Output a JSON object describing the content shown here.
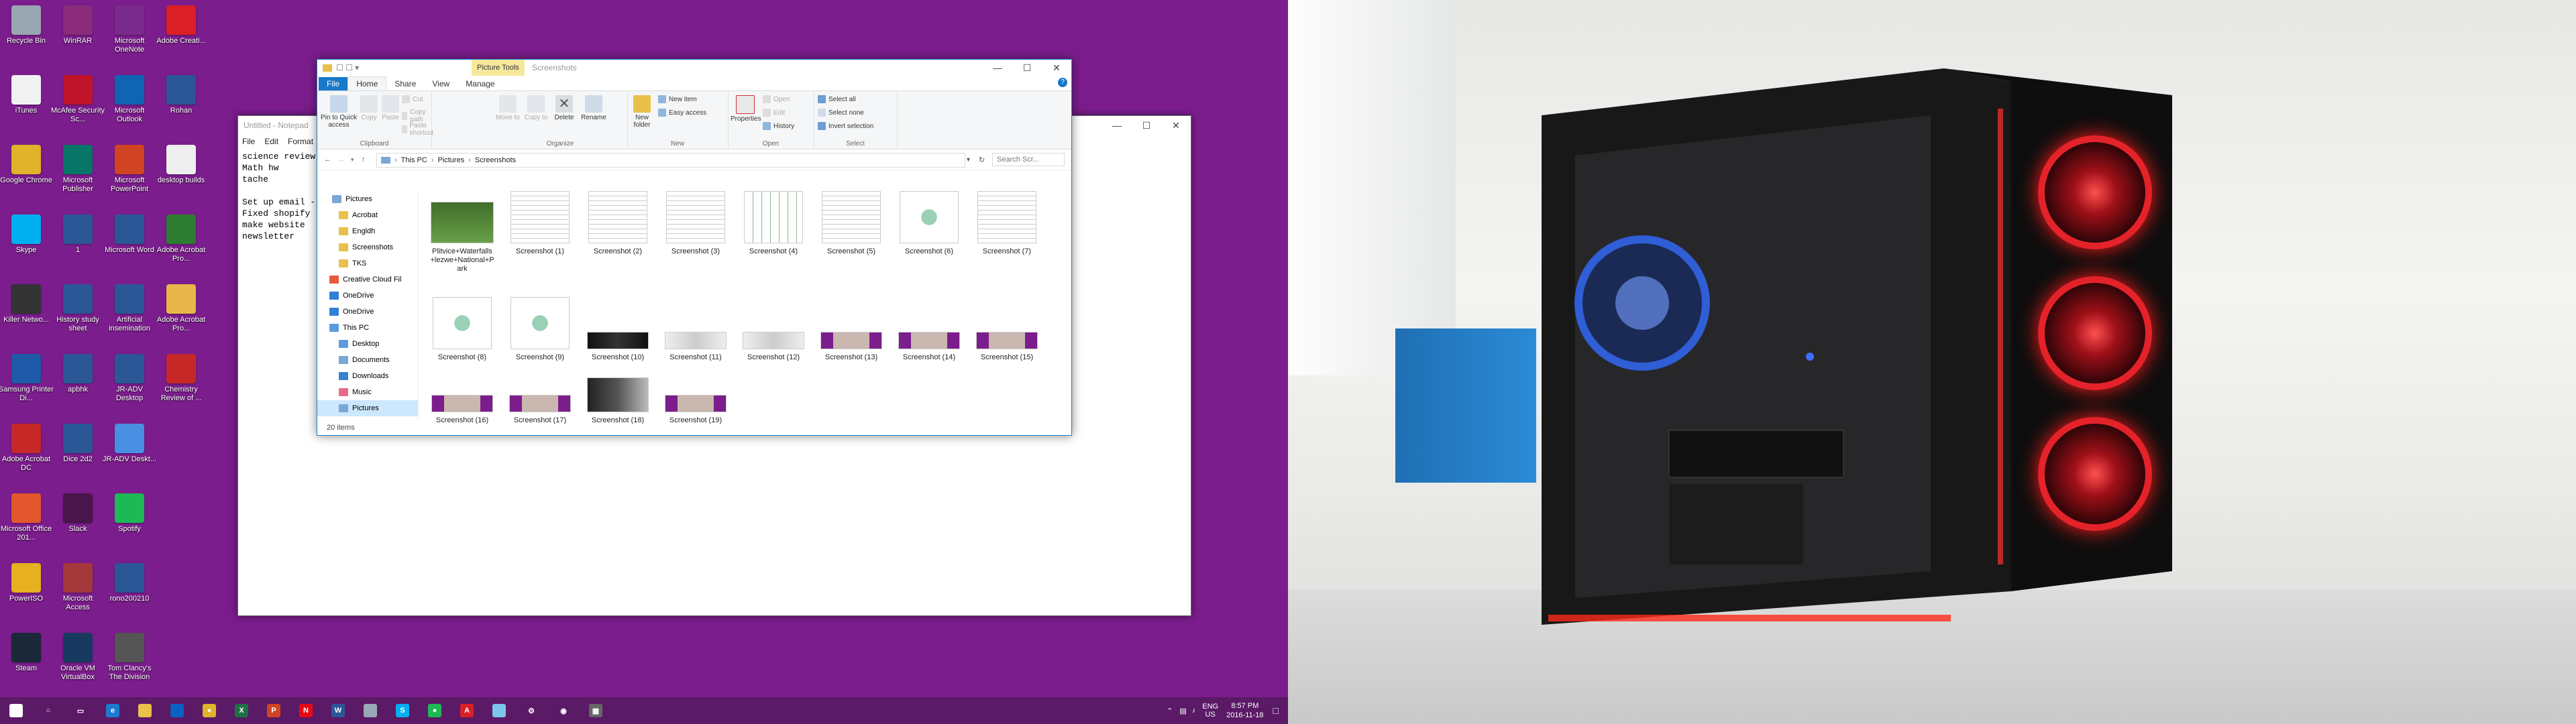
{
  "desktop": {
    "icons": [
      {
        "label": "Recycle Bin",
        "color": "#9aa6b2"
      },
      {
        "label": "WinRAR",
        "color": "#8a2c7b"
      },
      {
        "label": "Microsoft OneNote",
        "color": "#7b2b8c"
      },
      {
        "label": "Adobe Creati...",
        "color": "#da1f26"
      },
      {
        "label": "iTunes",
        "color": "#f2f2f2"
      },
      {
        "label": "McAfee Security Sc...",
        "color": "#c0142a"
      },
      {
        "label": "Microsoft Outlook",
        "color": "#0f64b4"
      },
      {
        "label": "Rohan",
        "color": "#2b5797"
      },
      {
        "label": "Google Chrome",
        "color": "#e0b32a"
      },
      {
        "label": "Microsoft Publisher",
        "color": "#077568"
      },
      {
        "label": "Microsoft PowerPoint",
        "color": "#d04423"
      },
      {
        "label": "desktop builds",
        "color": "#eeeeee"
      },
      {
        "label": "Skype",
        "color": "#00aff0"
      },
      {
        "label": "1",
        "color": "#2b5797"
      },
      {
        "label": "Microsoft Word",
        "color": "#2b5797"
      },
      {
        "label": "Adobe Acrobat Pro...",
        "color": "#2e7d32"
      },
      {
        "label": "Killer Netwo...",
        "color": "#333333"
      },
      {
        "label": "History study sheet",
        "color": "#2b5797"
      },
      {
        "label": "Artificial insemination",
        "color": "#2b5797"
      },
      {
        "label": "Adobe Acrobat Pro...",
        "color": "#e8b64a"
      },
      {
        "label": "Samsung Printer Di...",
        "color": "#1e5aa8"
      },
      {
        "label": "apbhk",
        "color": "#2b5797"
      },
      {
        "label": "JR-ADV Desktop",
        "color": "#2b5797"
      },
      {
        "label": "Chemistry Review of ...",
        "color": "#c62828"
      },
      {
        "label": "Adobe Acrobat DC",
        "color": "#c62828"
      },
      {
        "label": "Dice 2d2",
        "color": "#2b5797"
      },
      {
        "label": "JR-ADV Deskt...",
        "color": "#4a90e2"
      },
      {
        "label": "",
        "color": "transparent"
      },
      {
        "label": "Microsoft Office 201...",
        "color": "#e4572e"
      },
      {
        "label": "Slack",
        "color": "#4a154b"
      },
      {
        "label": "Spotify",
        "color": "#1db954"
      },
      {
        "label": "",
        "color": "transparent"
      },
      {
        "label": "PowerISO",
        "color": "#e6b020"
      },
      {
        "label": "Microsoft Access",
        "color": "#a4373a"
      },
      {
        "label": "rono200210",
        "color": "#2b5797"
      },
      {
        "label": "",
        "color": "transparent"
      },
      {
        "label": "Steam",
        "color": "#1b2838"
      },
      {
        "label": "Oracle VM VirtualBox",
        "color": "#183a61"
      },
      {
        "label": "Tom Clancy's The Division",
        "color": "#555555"
      }
    ]
  },
  "notepad": {
    "title": "Untitled - Notepad",
    "menu": [
      "File",
      "Edit",
      "Format"
    ],
    "text": "science review\nMath hw\ntache\n\nSet up email -\nFixed shopify\nmake website\nnewsletter"
  },
  "explorer": {
    "context_tab": "Picture Tools",
    "title": "Screenshots",
    "tabs": {
      "file": "File",
      "home": "Home",
      "share": "Share",
      "view": "View",
      "manage": "Manage"
    },
    "ribbon": {
      "pin": "Pin to Quick access",
      "copy": "Copy",
      "paste": "Paste",
      "cut": "Cut",
      "copy_path": "Copy path",
      "paste_shortcut": "Paste shortcut",
      "move_to": "Move to",
      "copy_to": "Copy to",
      "delete": "Delete",
      "rename": "Rename",
      "new_folder": "New folder",
      "new_item": "New item",
      "easy_access": "Easy access",
      "properties": "Properties",
      "open": "Open",
      "edit": "Edit",
      "history": "History",
      "select_all": "Select all",
      "select_none": "Select none",
      "invert_selection": "Invert selection",
      "groups": {
        "clipboard": "Clipboard",
        "organize": "Organize",
        "new": "New",
        "open": "Open",
        "select": "Select"
      }
    },
    "breadcrumb": [
      "This PC",
      "Pictures",
      "Screenshots"
    ],
    "search_placeholder": "Search Scr...",
    "nav": [
      "Pictures",
      "Acrobat",
      "Engldh",
      "Screenshots",
      "TKS",
      "Creative Cloud Fil",
      "OneDrive",
      "OneDrive",
      "This PC",
      "Desktop",
      "Documents",
      "Downloads",
      "Music",
      "Pictures"
    ],
    "files": [
      {
        "name": "Plitvice+Waterfalls+lezwe+National+Park",
        "kind": "photo"
      },
      {
        "name": "Screenshot (1)",
        "kind": "doc"
      },
      {
        "name": "Screenshot (2)",
        "kind": "doc"
      },
      {
        "name": "Screenshot (3)",
        "kind": "doc"
      },
      {
        "name": "Screenshot (4)",
        "kind": "table"
      },
      {
        "name": "Screenshot (5)",
        "kind": "doc"
      },
      {
        "name": "Screenshot (6)",
        "kind": "diagram"
      },
      {
        "name": "Screenshot (7)",
        "kind": "doc"
      },
      {
        "name": "Screenshot (8)",
        "kind": "diagram"
      },
      {
        "name": "Screenshot (9)",
        "kind": "diagram"
      },
      {
        "name": "Screenshot (10)",
        "kind": "dark"
      },
      {
        "name": "Screenshot (11)",
        "kind": "light"
      },
      {
        "name": "Screenshot (12)",
        "kind": "light"
      },
      {
        "name": "Screenshot (13)",
        "kind": "purple"
      },
      {
        "name": "Screenshot (14)",
        "kind": "purple"
      },
      {
        "name": "Screenshot (15)",
        "kind": "purple"
      },
      {
        "name": "Screenshot (16)",
        "kind": "purple"
      },
      {
        "name": "Screenshot (17)",
        "kind": "purple"
      },
      {
        "name": "Screenshot (18)",
        "kind": "case"
      },
      {
        "name": "Screenshot (19)",
        "kind": "purple"
      }
    ],
    "status": "20 items"
  },
  "taskbar": {
    "apps": [
      "start",
      "search",
      "task-view",
      "edge",
      "file-explorer",
      "store",
      "chrome",
      "excel",
      "powerpoint",
      "netflix",
      "word",
      "snipping",
      "skype",
      "spotify",
      "acrobat",
      "notepad",
      "settings",
      "steam",
      "calculator"
    ],
    "lang": "ENG",
    "region": "US",
    "time": "8:57 PM",
    "date": "2016-11-18"
  }
}
